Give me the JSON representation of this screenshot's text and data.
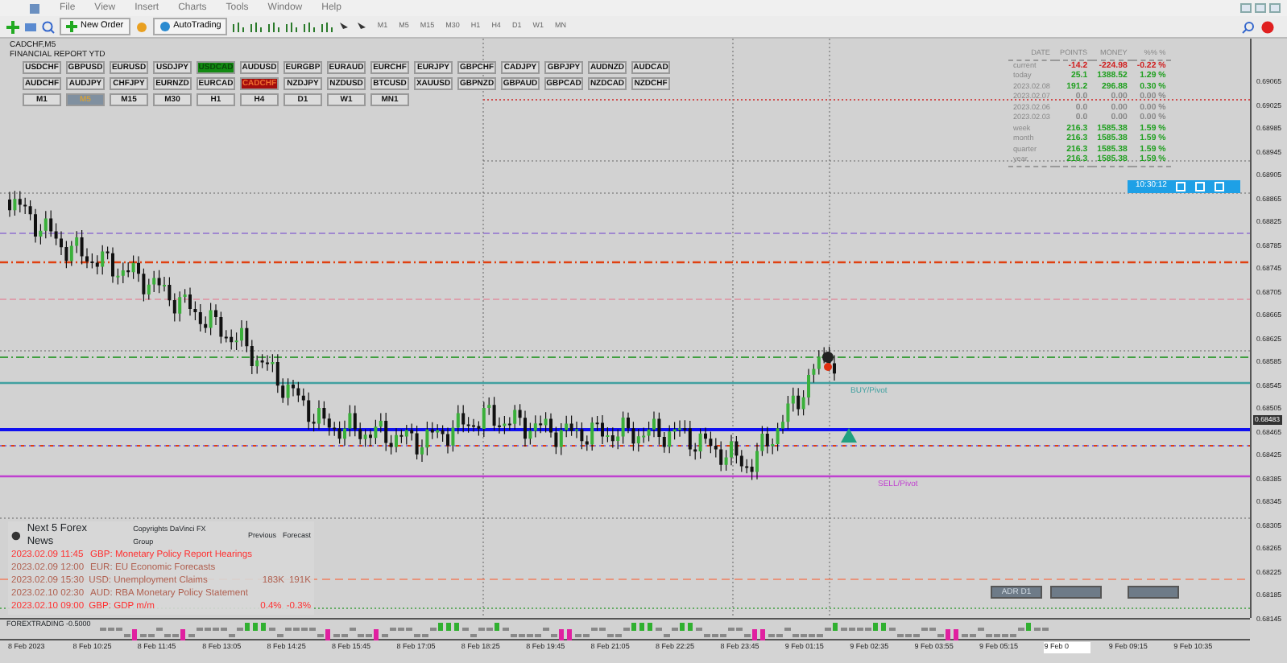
{
  "menu": [
    "File",
    "View",
    "Insert",
    "Charts",
    "Tools",
    "Window",
    "Help"
  ],
  "toolbar": {
    "new_order": "New Order",
    "auto_trading": "AutoTrading",
    "timeframes": [
      "M1",
      "M5",
      "M15",
      "M30",
      "H1",
      "H4",
      "D1",
      "W1",
      "MN"
    ]
  },
  "chart": {
    "title": "CADCHF,M5",
    "subtitle": "FINANCIAL REPORT YTD",
    "symbols": [
      {
        "label": "USDCHF",
        "selected": false,
        "highlighted": false
      },
      {
        "label": "GBPUSD",
        "selected": false,
        "highlighted": false
      },
      {
        "label": "EURUSD",
        "selected": false,
        "highlighted": false
      },
      {
        "label": "USDJPY",
        "selected": false,
        "highlighted": false
      },
      {
        "label": "USDCAD",
        "selected": false,
        "highlighted": true
      },
      {
        "label": "AUDUSD",
        "selected": false,
        "highlighted": false
      },
      {
        "label": "EURGBP",
        "selected": false,
        "highlighted": false
      },
      {
        "label": "EURAUD",
        "selected": false,
        "highlighted": false
      },
      {
        "label": "EURCHF",
        "selected": false,
        "highlighted": false
      },
      {
        "label": "EURJPY",
        "selected": false,
        "highlighted": false
      },
      {
        "label": "GBPCHF",
        "selected": false,
        "highlighted": false
      },
      {
        "label": "CADJPY",
        "selected": false,
        "highlighted": false
      },
      {
        "label": "GBPJPY",
        "selected": false,
        "highlighted": false
      },
      {
        "label": "AUDNZD",
        "selected": false,
        "highlighted": false
      },
      {
        "label": "AUDCAD",
        "selected": false,
        "highlighted": false
      },
      {
        "label": "AUDCHF",
        "selected": false,
        "highlighted": false
      },
      {
        "label": "AUDJPY",
        "selected": false,
        "highlighted": false
      },
      {
        "label": "CHFJPY",
        "selected": false,
        "highlighted": false
      },
      {
        "label": "EURNZD",
        "selected": false,
        "highlighted": false
      },
      {
        "label": "EURCAD",
        "selected": false,
        "highlighted": false
      },
      {
        "label": "CADCHF",
        "selected": true,
        "highlighted": false
      },
      {
        "label": "NZDJPY",
        "selected": false,
        "highlighted": false
      },
      {
        "label": "NZDUSD",
        "selected": false,
        "highlighted": false
      },
      {
        "label": "BTCUSD",
        "selected": false,
        "highlighted": false
      },
      {
        "label": "XAUUSD",
        "selected": false,
        "highlighted": false
      },
      {
        "label": "GBPNZD",
        "selected": false,
        "highlighted": false
      },
      {
        "label": "GBPAUD",
        "selected": false,
        "highlighted": false
      },
      {
        "label": "GBPCAD",
        "selected": false,
        "highlighted": false
      },
      {
        "label": "NZDCAD",
        "selected": false,
        "highlighted": false
      },
      {
        "label": "NZDCHF",
        "selected": false,
        "highlighted": false
      }
    ],
    "periods": [
      {
        "label": "M1",
        "selected": false
      },
      {
        "label": "M5",
        "selected": true
      },
      {
        "label": "M15",
        "selected": false
      },
      {
        "label": "M30",
        "selected": false
      },
      {
        "label": "H1",
        "selected": false
      },
      {
        "label": "H4",
        "selected": false
      },
      {
        "label": "D1",
        "selected": false
      },
      {
        "label": "W1",
        "selected": false
      },
      {
        "label": "MN1",
        "selected": false
      }
    ],
    "report": {
      "columns": [
        "DATE",
        "POINTS",
        "MONEY",
        "%% %"
      ],
      "rows": [
        {
          "color": "#d02020",
          "date": "current",
          "points": "-14.2",
          "money": "-224.98",
          "percent": "-0.22 %"
        },
        {
          "color": "#20a020",
          "date": "today",
          "points": "25.1",
          "money": "1388.52",
          "percent": "1.29 %"
        },
        {
          "color": "#20a020",
          "date": "2023.02.08",
          "points": "191.2",
          "money": "296.88",
          "percent": "0.30 %"
        },
        {
          "color": "#888888",
          "date": "2023.02.07",
          "points": "0.0",
          "money": "0.00",
          "percent": "0.00 %"
        },
        {
          "color": "#888888",
          "date": "2023.02.06",
          "points": "0.0",
          "money": "0.00",
          "percent": "0.00 %"
        },
        {
          "color": "#888888",
          "date": "2023.02.03",
          "points": "0.0",
          "money": "0.00",
          "percent": "0.00 %"
        },
        {
          "color": "#20a020",
          "date": "week",
          "points": "216.3",
          "money": "1585.38",
          "percent": "1.59 %"
        },
        {
          "color": "#20a020",
          "date": "month",
          "points": "216.3",
          "money": "1585.38",
          "percent": "1.59 %"
        },
        {
          "color": "#20a020",
          "date": "quarter",
          "points": "216.3",
          "money": "1585.38",
          "percent": "1.59 %"
        },
        {
          "color": "#20a020",
          "date": "year",
          "points": "216.3",
          "money": "1585.38",
          "percent": "1.59 %"
        }
      ]
    },
    "clock": "10:30:12",
    "level_labels": [
      "BUY/Pivot",
      "SELL/Pivot"
    ],
    "adr_button": "ADR D1",
    "news": {
      "title": "Next 5 Forex News",
      "copyright": "Copyrights DaVinci FX Group",
      "previous": "Previous",
      "forecast": "Forecast",
      "items": [
        {
          "color": "#ff3030",
          "time": "2023.02.09 11:45",
          "event": "GBP: Monetary Policy Report Hearings"
        },
        {
          "color": "#b06050",
          "time": "2023.02.09 12:00",
          "event": "EUR: EU Economic Forecasts"
        },
        {
          "color": "#b06050",
          "time": "2023.02.09 15:30",
          "event": "USD: Unemployment Claims",
          "previous": "183K",
          "forecast": "191K"
        },
        {
          "color": "#b06050",
          "time": "2023.02.10 02:30",
          "event": "AUD: RBA Monetary Policy Statement"
        },
        {
          "color": "#ff3030",
          "time": "2023.02.10 09:00",
          "event": "GBP: GDP m/m",
          "previous": "0.4%",
          "forecast": "-0.3%"
        }
      ]
    },
    "price_axis": [
      "0.69065",
      "0.69025",
      "0.68985",
      "0.68945",
      "0.68905",
      "0.68865",
      "0.68825",
      "0.68785",
      "0.68745",
      "0.68705",
      "0.68665",
      "0.68625",
      "0.68585",
      "0.68545",
      "0.68505",
      "0.68465",
      "0.68425",
      "0.68385",
      "0.68345",
      "0.68305",
      "0.68265",
      "0.68225",
      "0.68185",
      "0.68145"
    ],
    "current_price": "0.68483",
    "indicator": {
      "label": "FOREXTRADING -0.5000"
    },
    "time_axis": [
      "8 Feb 2023",
      "8 Feb 10:25",
      "8 Feb 11:45",
      "8 Feb 13:05",
      "8 Feb 14:25",
      "8 Feb 15:45",
      "8 Feb 17:05",
      "8 Feb 18:25",
      "8 Feb 19:45",
      "8 Feb 21:05",
      "8 Feb 22:25",
      "8 Feb 23:45",
      "9 Feb 01:15",
      "9 Feb 02:35",
      "9 Feb 03:55",
      "9 Feb 05:15",
      "9 Feb 0",
      "9 Feb 09:15",
      "9 Feb 10:35"
    ]
  }
}
